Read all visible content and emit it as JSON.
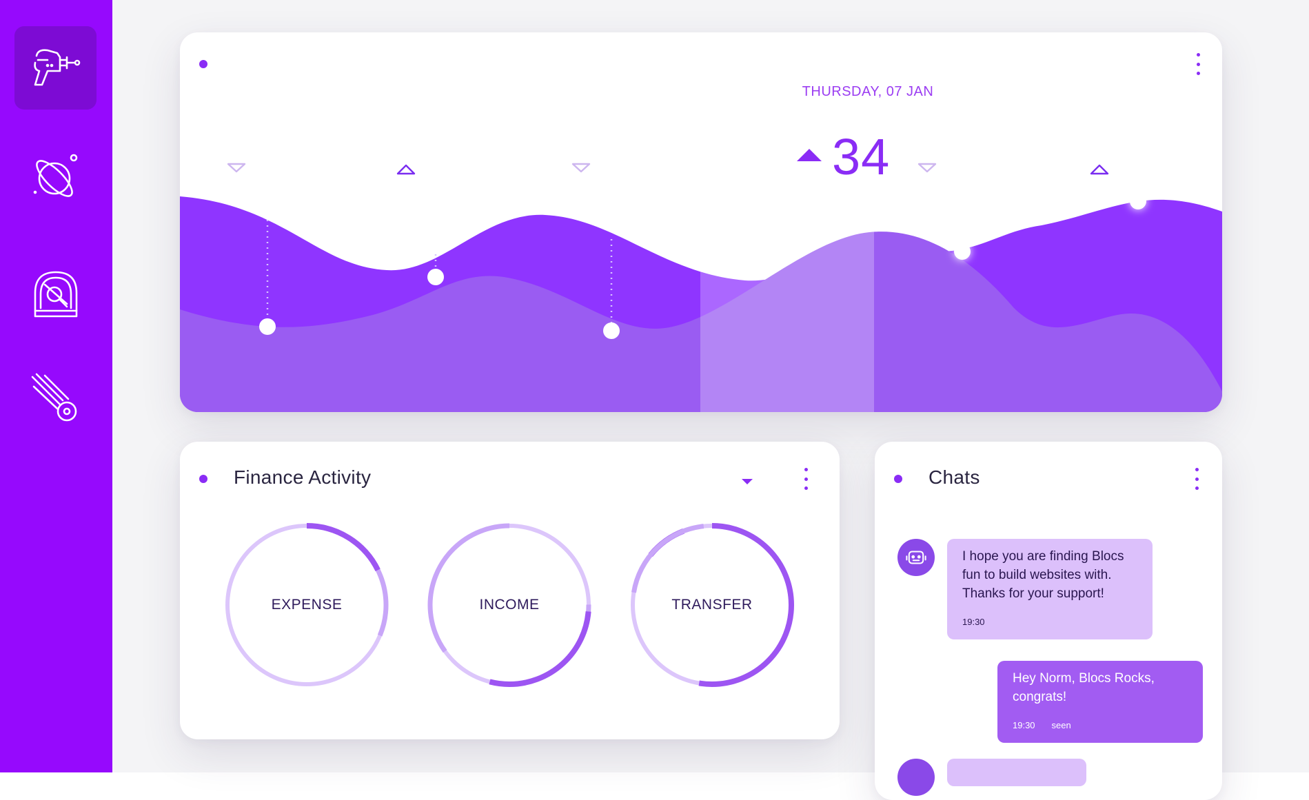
{
  "sidebar": {
    "items": [
      {
        "name": "ray-gun-icon",
        "active": true
      },
      {
        "name": "planet-icon",
        "active": false
      },
      {
        "name": "astronaut-helmet-icon",
        "active": false
      },
      {
        "name": "meteor-icon",
        "active": false
      }
    ]
  },
  "header_chart": {
    "date_label": "THURSDAY, 07 JAN",
    "highlight_value": "34",
    "highlight_trend": "up",
    "markers": [
      "down",
      "up",
      "down",
      "up",
      "down",
      "up"
    ]
  },
  "finance": {
    "title": "Finance Activity",
    "rings": [
      {
        "label": "EXPENSE"
      },
      {
        "label": "INCOME"
      },
      {
        "label": "TRANSFER"
      }
    ]
  },
  "chats": {
    "title": "Chats",
    "messages": [
      {
        "direction": "in",
        "text": "I hope you are finding Blocs fun to build websites with. Thanks for your support!",
        "time": "19:30"
      },
      {
        "direction": "out",
        "text": "Hey Norm, Blocs Rocks, congrats!",
        "time": "19:30",
        "status": "seen"
      }
    ]
  },
  "colors": {
    "sidebar": "#9609fd",
    "accent": "#8a2cf5",
    "bubble_in": "#dcc0fb",
    "bubble_out": "#a25cf2"
  }
}
